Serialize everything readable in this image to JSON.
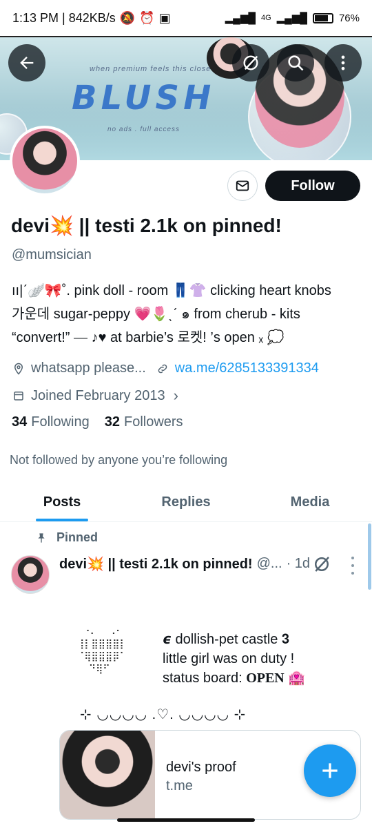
{
  "status_bar": {
    "time_speed": "1:13 PM | 842KB/s",
    "network": "4G",
    "battery": "76%",
    "battery_level": 0.76
  },
  "banner": {
    "title": "BLUSH",
    "tagline_top": "when premium feels this close",
    "tagline_bottom": "no ads . full access"
  },
  "header_buttons": {
    "back": "back-arrow-icon",
    "grok": "no-eye-icon",
    "search": "search-icon",
    "more": "more-vertical-icon"
  },
  "profile": {
    "display_name": "devi💥 || testi 2.1k on pinned!",
    "handle": "@mumsician",
    "bio_lines": [
      "ıı|ˊ🪽🎀˚. pink doll - room  👖👚 clicking heart knobs",
      "가운데 sugar-peppy 💗🌷ˎˊ ๑ from cherub - kits",
      "“convert!” ⎯⎯ ♪♥ at barbie’s 로켓! ’s open ₓ 💭"
    ],
    "location": "whatsapp please...",
    "website": "wa.me/6285133391334",
    "joined": "Joined February 2013",
    "following_count": "34",
    "following_label": "Following",
    "followers_count": "32",
    "followers_label": "Followers",
    "not_followed": "Not followed by anyone you’re following"
  },
  "actions": {
    "message_icon": "envelope-icon",
    "follow_label": "Follow"
  },
  "tabs": [
    {
      "label": "Posts",
      "active": true
    },
    {
      "label": "Replies",
      "active": false
    },
    {
      "label": "Media",
      "active": false
    }
  ],
  "pinned_post": {
    "pinned_label": "Pinned",
    "author_name": "devi💥 || testi 2.1k on pinned!",
    "author_handle": "@...",
    "time": "· 1d",
    "braille_art": " ⠐⠄  ⠠⠂\n⢸⡇⣿⣿⣿⣿⡇\n⠈⢿⣿⣿⣿⡿⠁\n  ⠙⢿⠋",
    "line1": "𝟄  dollish-pet castle  𝟑",
    "line2": "little girl was  on  duty !",
    "line3_prefix": "status board: ",
    "line3_strong": "OPEN",
    "line3_suffix": " 🏩",
    "divider": "⊹  ◡◡◡◡  .♡.  ◡◡◡◡  ⊹",
    "card_title": "devi's proof",
    "card_domain": "t.me"
  },
  "colors": {
    "accent": "#1d9bf0",
    "text": "#0f1419",
    "secondary": "#536471"
  }
}
